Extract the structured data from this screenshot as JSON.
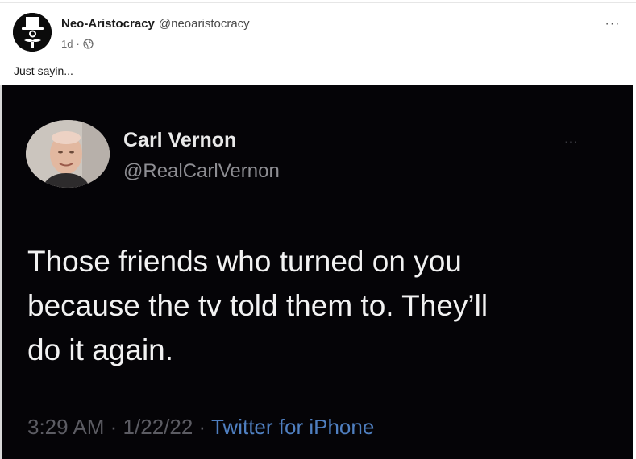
{
  "post": {
    "author_name": "Neo-Aristocracy",
    "author_handle": "@neoaristocracy",
    "age": "1d",
    "meta_separator": "·",
    "visibility_icon": "globe-icon",
    "more_label": "···",
    "text": "Just sayin..."
  },
  "embedded_tweet": {
    "name": "Carl Vernon",
    "handle": "@RealCarlVernon",
    "more_label": "···",
    "lines": [
      "Those friends who turned on you",
      "because the tv told them to. They’ll",
      "do it again."
    ],
    "time": "3:29 AM",
    "separator": "·",
    "date": "1/22/22",
    "source": "Twitter for iPhone"
  },
  "colors": {
    "media_background": "#050407",
    "tweet_text": "#f2f2f2",
    "tweet_secondary": "#8e8e93",
    "tweet_link": "#4f7fc0"
  }
}
